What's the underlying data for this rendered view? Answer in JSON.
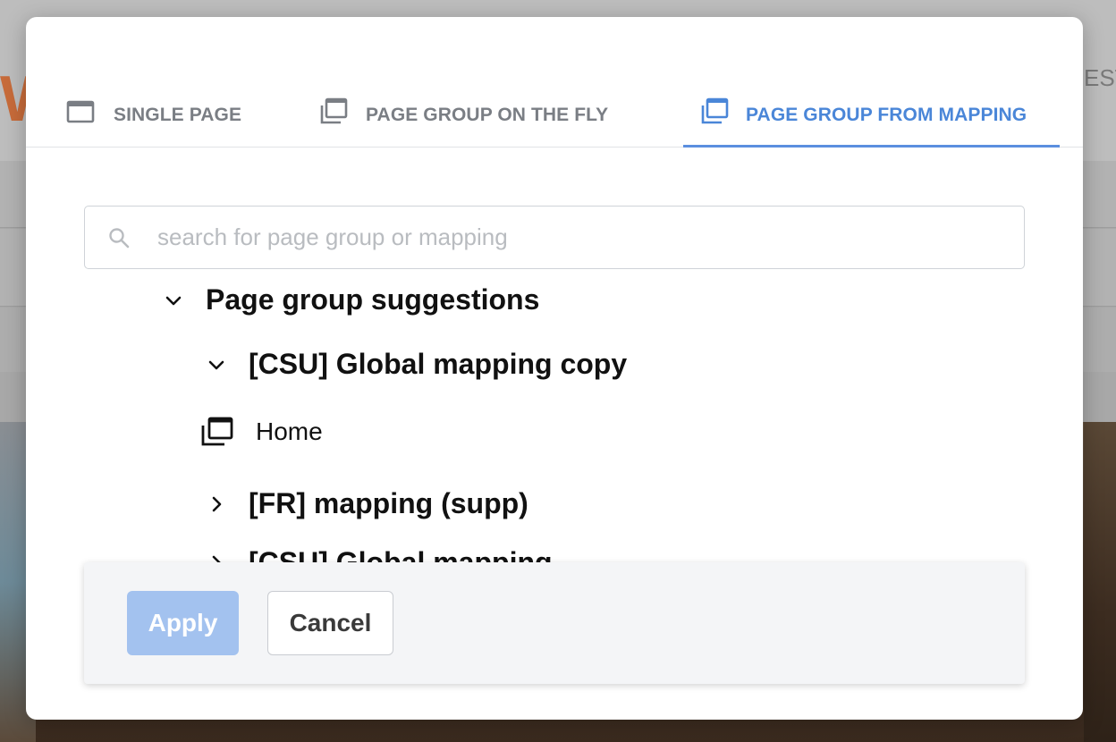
{
  "background": {
    "logo_text": "W",
    "right_text": "EST"
  },
  "tabs": [
    {
      "label": "SINGLE PAGE",
      "icon": "single-page-icon",
      "active": false
    },
    {
      "label": "PAGE GROUP ON THE FLY",
      "icon": "page-group-icon",
      "active": false
    },
    {
      "label": "PAGE GROUP FROM MAPPING",
      "icon": "page-group-icon",
      "active": true
    }
  ],
  "search": {
    "placeholder": "search for page group or mapping",
    "value": "",
    "icon": "search-icon"
  },
  "tree": {
    "root": {
      "label": "Page group suggestions",
      "expanded": true
    },
    "items": [
      {
        "label": "[CSU] Global mapping copy",
        "expanded": true,
        "icon": "chevron-down-icon"
      },
      {
        "label": "Home",
        "icon": "page-group-icon"
      },
      {
        "label": "[FR] mapping (supp)",
        "expanded": false,
        "icon": "chevron-right-icon"
      },
      {
        "label": "[CSU] Global mapping",
        "expanded": false,
        "icon": "chevron-right-icon"
      }
    ]
  },
  "footer": {
    "apply_label": "Apply",
    "cancel_label": "Cancel"
  },
  "colors": {
    "accent": "#4a86d8",
    "tab_inactive": "#7a7e84",
    "apply_disabled_bg": "#a3c2ef",
    "footer_bg": "#f4f5f7"
  }
}
